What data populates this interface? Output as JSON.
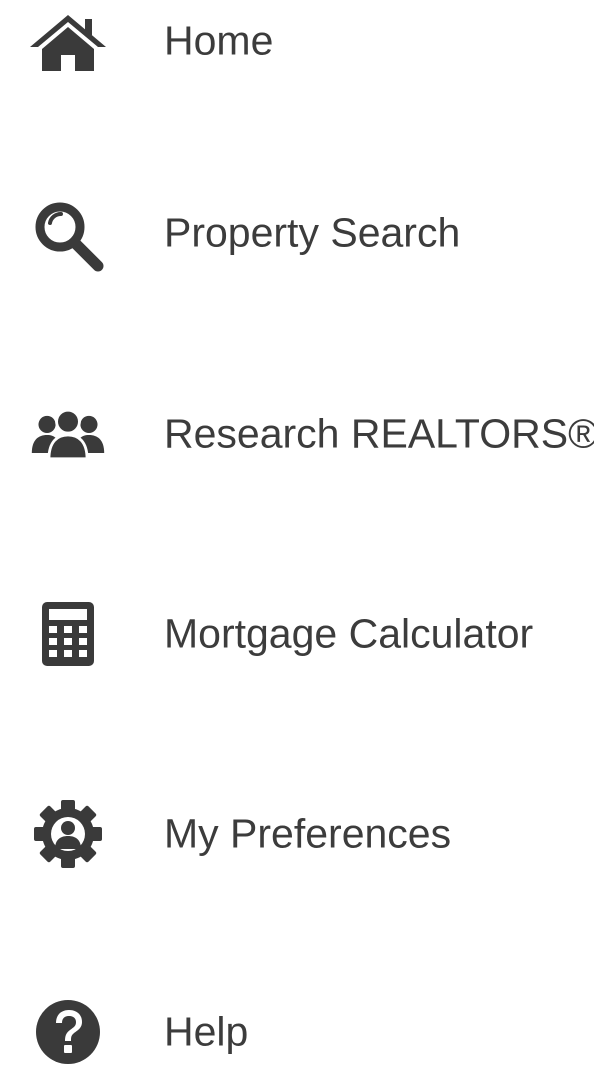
{
  "nav": {
    "items": [
      {
        "id": "home",
        "label": "Home",
        "icon": "home-icon"
      },
      {
        "id": "property-search",
        "label": "Property Search",
        "icon": "magnifier-icon"
      },
      {
        "id": "research-realtors",
        "label": "Research REALTORS®",
        "icon": "users-icon"
      },
      {
        "id": "mortgage-calculator",
        "label": "Mortgage Calculator",
        "icon": "calculator-icon"
      },
      {
        "id": "my-preferences",
        "label": "My Preferences",
        "icon": "user-gear-icon"
      },
      {
        "id": "help",
        "label": "Help",
        "icon": "question-circle-icon"
      }
    ]
  },
  "colors": {
    "icon": "#3a3a3a",
    "text": "#3c3c3c",
    "background": "#ffffff"
  }
}
